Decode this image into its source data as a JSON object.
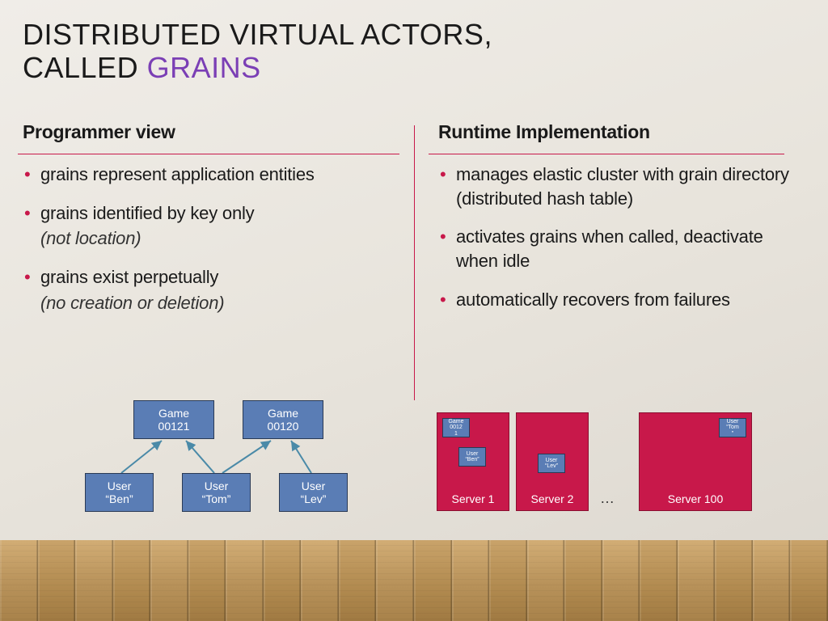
{
  "title": {
    "line1": "DISTRIBUTED VIRTUAL ACTORS,",
    "line2_prefix": "CALLED ",
    "line2_accent": "GRAINS"
  },
  "left": {
    "heading": "Programmer view",
    "items": [
      {
        "text": "grains represent application entities",
        "sub": ""
      },
      {
        "text": "grains identified by key only",
        "sub": "(not location)"
      },
      {
        "text": "grains exist perpetually",
        "sub": "(no creation or deletion)"
      }
    ],
    "diagram": {
      "game1": "Game\n00121",
      "game2": "Game\n00120",
      "user1": "User\n“Ben”",
      "user2": "User\n“Tom”",
      "user3": "User\n“Lev”"
    }
  },
  "right": {
    "heading": "Runtime Implementation",
    "items": [
      {
        "text": "manages elastic cluster with grain directory (distributed hash table)"
      },
      {
        "text": "activates grains when called, deactivate when idle"
      },
      {
        "text": "automatically recovers from failures"
      }
    ],
    "servers": {
      "s1": "Server 1",
      "s2": "Server 2",
      "sN": "Server 100",
      "ellipsis": "…"
    },
    "mini": {
      "g1": "Game\n0012\n1",
      "u1": "User\n“Ben”",
      "u2": "User\n“Lev”",
      "u3": "User\n“Tom\n”"
    }
  },
  "colors": {
    "accent_purple": "#7b3fb5",
    "rule_red": "#c8184a",
    "box_blue": "#5a7db5",
    "server_red": "#c8184a"
  }
}
